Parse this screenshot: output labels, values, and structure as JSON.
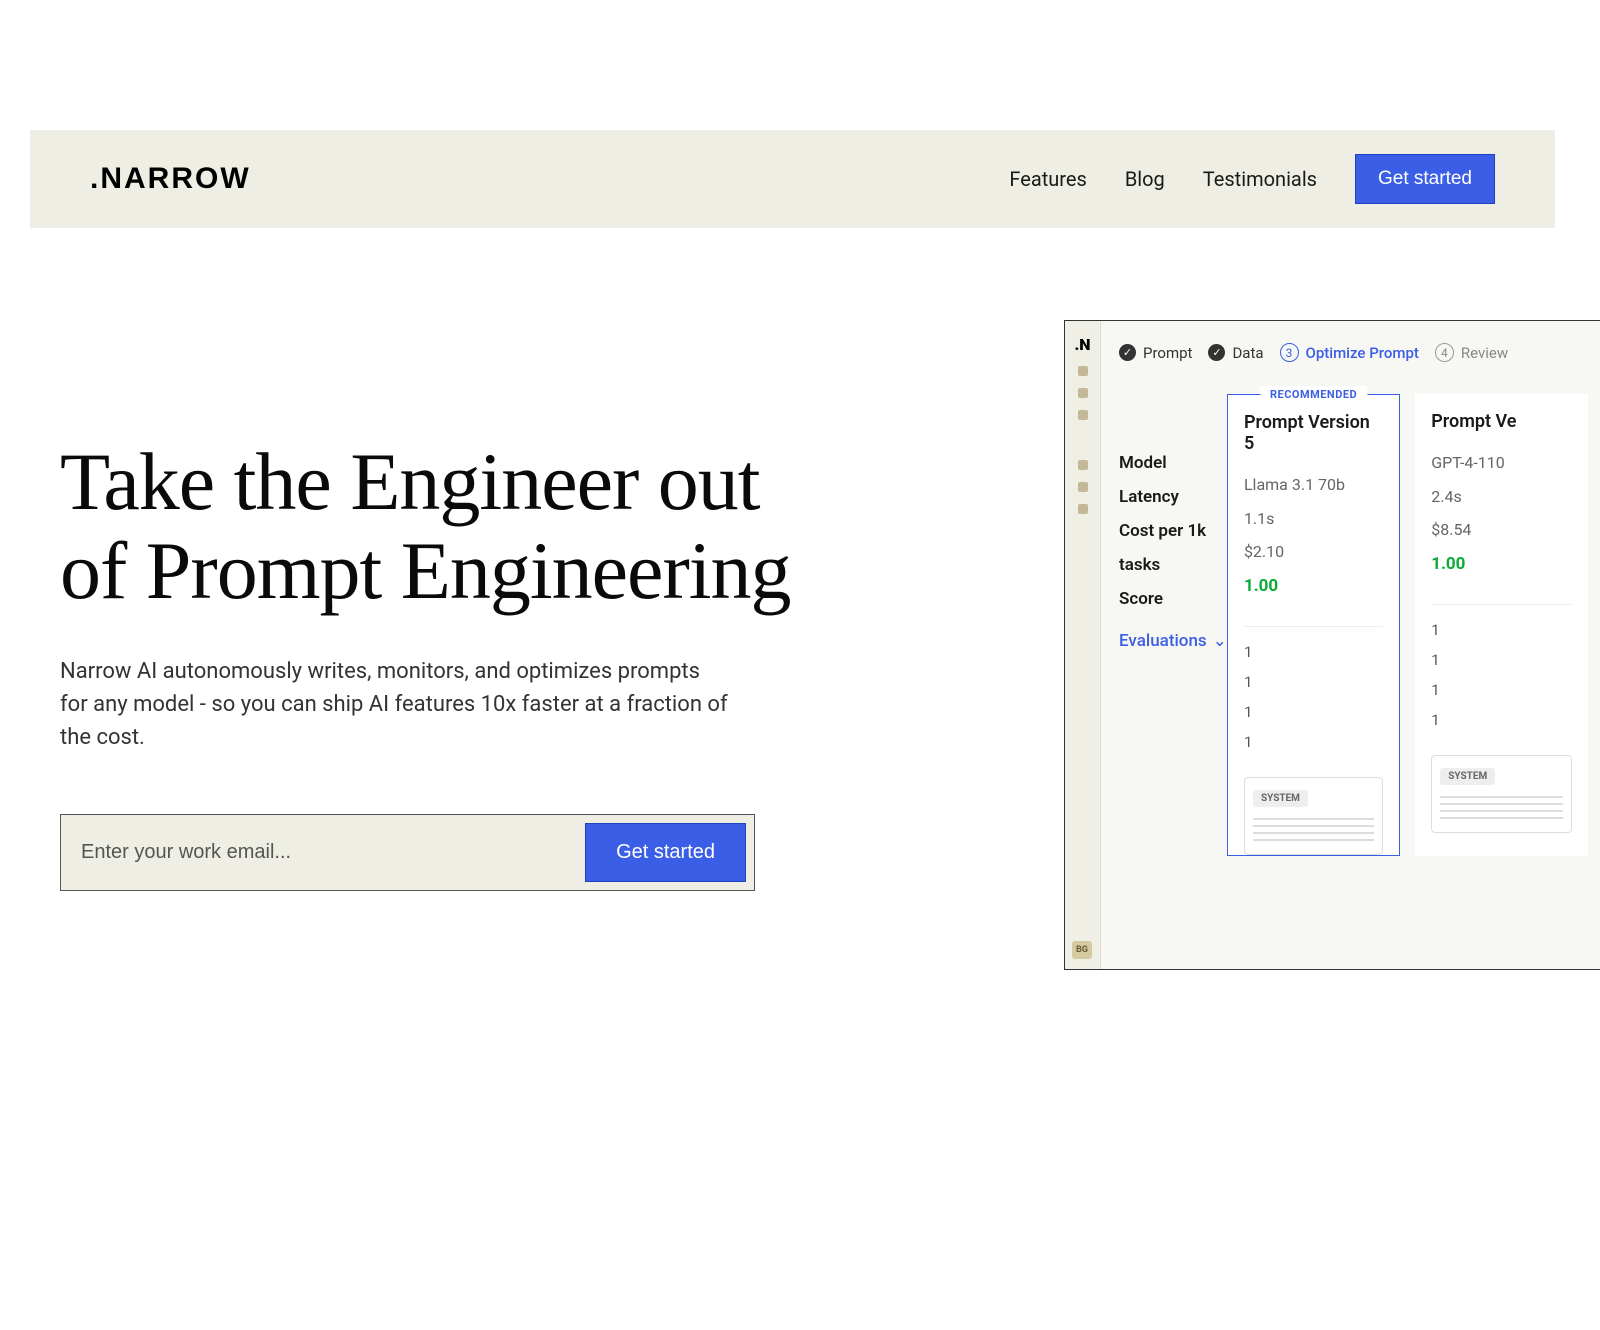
{
  "header": {
    "logo": ".NARROW",
    "nav": {
      "features": "Features",
      "blog": "Blog",
      "testimonials": "Testimonials"
    },
    "cta": "Get started"
  },
  "hero": {
    "title": "Take the Engineer out of Prompt Engineering",
    "subtitle": "Narrow AI autonomously writes, monitors, and optimizes prompts for any model - so you can ship AI features 10x faster at a fraction of the cost.",
    "email_placeholder": "Enter your work email...",
    "submit": "Get started"
  },
  "preview": {
    "logo": ".N",
    "user_badge": "BG",
    "steps": {
      "s1": "Prompt",
      "s2": "Data",
      "s3_num": "3",
      "s3": "Optimize Prompt",
      "s4_num": "4",
      "s4": "Review"
    },
    "labels": {
      "model": "Model",
      "latency": "Latency",
      "cost": "Cost per 1k tasks",
      "score": "Score",
      "evaluations": "Evaluations"
    },
    "card1": {
      "badge": "RECOMMENDED",
      "title": "Prompt Version 5",
      "model": "Llama 3.1 70b",
      "latency": "1.1s",
      "cost": "$2.10",
      "score": "1.00",
      "e1": "1",
      "e2": "1",
      "e3": "1",
      "e4": "1",
      "system": "SYSTEM"
    },
    "card2": {
      "title": "Prompt Ve",
      "model": "GPT-4-110",
      "latency": "2.4s",
      "cost": "$8.54",
      "score": "1.00",
      "e1": "1",
      "e2": "1",
      "e3": "1",
      "e4": "1",
      "system": "SYSTEM"
    }
  }
}
